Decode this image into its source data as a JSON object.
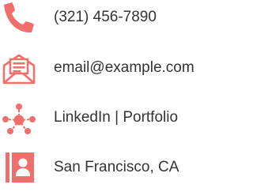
{
  "contacts": [
    {
      "icon": "phone-icon",
      "text": "(321) 456-7890"
    },
    {
      "icon": "envelope-icon",
      "text": "email@example.com"
    },
    {
      "icon": "network-icon",
      "text": "LinkedIn | Portfolio"
    },
    {
      "icon": "id-card-icon",
      "text": "San Francisco, CA"
    }
  ],
  "colors": {
    "accent": "#ee6f6b",
    "text": "#333333"
  }
}
